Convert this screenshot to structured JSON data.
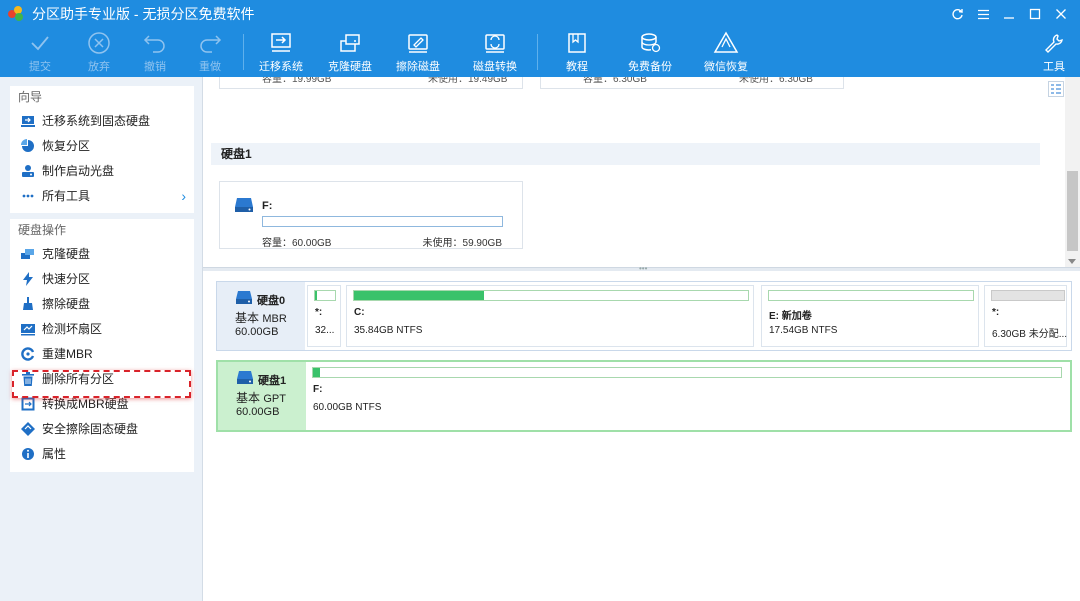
{
  "app": {
    "title": "分区助手专业版 - 无损分区免费软件",
    "brand_color": "#1f8ce0",
    "window_controls": [
      "refresh-icon",
      "menu-icon",
      "minimize-icon",
      "maximize-icon",
      "close-icon"
    ]
  },
  "toolbar": {
    "commit": "提交",
    "discard": "放弃",
    "undo": "撤销",
    "redo": "重做",
    "migrate_os": "迁移系统",
    "clone_disk": "克隆硬盘",
    "wipe_disk": "擦除磁盘",
    "convert_disk": "磁盘转换",
    "tutorial": "教程",
    "free_backup": "免费备份",
    "wechat_restore": "微信恢复",
    "tools": "工具"
  },
  "sidebar": {
    "wizard": {
      "title": "向导",
      "items": [
        {
          "label": "迁移系统到固态硬盘",
          "icon": "migrate-icon"
        },
        {
          "label": "恢复分区",
          "icon": "recover-partition-icon"
        },
        {
          "label": "制作启动光盘",
          "icon": "bootable-media-icon"
        },
        {
          "label": "所有工具",
          "icon": "more-tools-icon"
        }
      ]
    },
    "disk_ops": {
      "title": "硬盘操作",
      "items": [
        {
          "label": "克隆硬盘",
          "icon": "clone-disk-icon"
        },
        {
          "label": "快速分区",
          "icon": "quick-partition-icon"
        },
        {
          "label": "擦除硬盘",
          "icon": "wipe-disk-icon"
        },
        {
          "label": "检测坏扇区",
          "icon": "bad-sector-icon"
        },
        {
          "label": "重建MBR",
          "icon": "rebuild-mbr-icon"
        },
        {
          "label": "删除所有分区",
          "icon": "delete-all-partitions-icon"
        },
        {
          "label": "转换成MBR硬盘",
          "icon": "convert-mbr-icon"
        },
        {
          "label": "安全擦除固态硬盘",
          "icon": "secure-erase-ssd-icon"
        },
        {
          "label": "属性",
          "icon": "properties-icon"
        }
      ]
    }
  },
  "upper_view": {
    "frag_left": {
      "cap": "容量：19.99GB",
      "free": "未使用：19.49GB"
    },
    "frag_right": {
      "cap": "容量：6.30GB",
      "free": "未使用：6.30GB"
    },
    "disk1_title": "硬盘1",
    "disk1_card": {
      "label": "F:",
      "capacity": "容量：60.00GB",
      "unused": "未使用：59.90GB"
    }
  },
  "disks": [
    {
      "name": "硬盘0",
      "type_prefix": "基本",
      "type": "MBR",
      "size": "60.00GB",
      "partitions": [
        {
          "name": "*:",
          "info": "32...",
          "usage": 0.12
        },
        {
          "name": "C:",
          "info": "35.84GB NTFS",
          "usage": 0.33
        },
        {
          "name": "E: 新加卷",
          "info": "17.54GB NTFS",
          "usage": 0.0
        },
        {
          "name": "*:",
          "info": "6.30GB 未分配...",
          "usage": 0,
          "unallocated": true
        }
      ]
    },
    {
      "name": "硬盘1",
      "type_prefix": "基本",
      "type": "GPT",
      "size": "60.00GB",
      "partitions": [
        {
          "name": "F:",
          "info": "60.00GB NTFS",
          "usage": 0.01
        }
      ]
    }
  ]
}
